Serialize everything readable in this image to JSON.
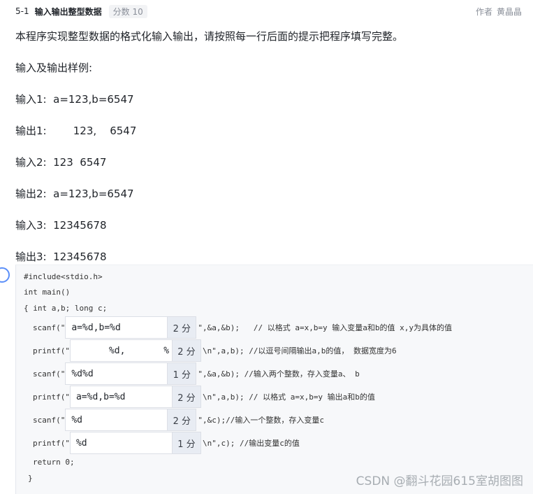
{
  "header": {
    "question_number": "5-1",
    "title": "输入输出整型数据",
    "score": "分数 10",
    "author_label": "作者",
    "author_name": "黄晶晶"
  },
  "description": {
    "intro": "本程序实现整型数据的格式化输入输出，请按照每一行后面的提示把程序填写完整。",
    "sample_heading": "输入及输出样例:",
    "samples": [
      "输入1:  a=123,b=6547",
      "输出1:        123,    6547",
      "输入2:  123  6547",
      "输出2:  a=123,b=6547",
      "输入3:  12345678",
      "输出3:  12345678"
    ]
  },
  "code": {
    "line1": "#include<stdio.h>",
    "line2": "int main()",
    "line3": "{ int a,b; long c;",
    "return_line": "return 0;",
    "close_brace": "}",
    "blanks": [
      {
        "prefix": "scanf(\"",
        "value": "a=%d,b=%d",
        "score": "2 分",
        "suffix": "\",&a,&b);   // 以格式 a=x,b=y 输入变量a和b的值 x,y为具体的值"
      },
      {
        "prefix": "printf(\"",
        "value": "      %d,       %",
        "score": "2 分",
        "suffix": "\\n\",a,b); //以逗号间隔输出a,b的值， 数据宽度为6"
      },
      {
        "prefix": "scanf(\"",
        "value": "%d%d",
        "score": "1 分",
        "suffix": "\",&a,&b); //输入两个整数，存入变量a、 b"
      },
      {
        "prefix": "printf(\"",
        "value": "a=%d,b=%d",
        "score": "2 分",
        "suffix": "\\n\",a,b); // 以格式 a=x,b=y 输出a和b的值"
      },
      {
        "prefix": "scanf(\"",
        "value": "%d",
        "score": "2 分",
        "suffix": "\",&c);//输入一个整数，存入变量c"
      },
      {
        "prefix": "printf(\"",
        "value": "%d",
        "score": "1 分",
        "suffix": "\\n\",c); //输出变量c的值"
      }
    ]
  },
  "watermark": "CSDN @翻斗花园615室胡图图"
}
